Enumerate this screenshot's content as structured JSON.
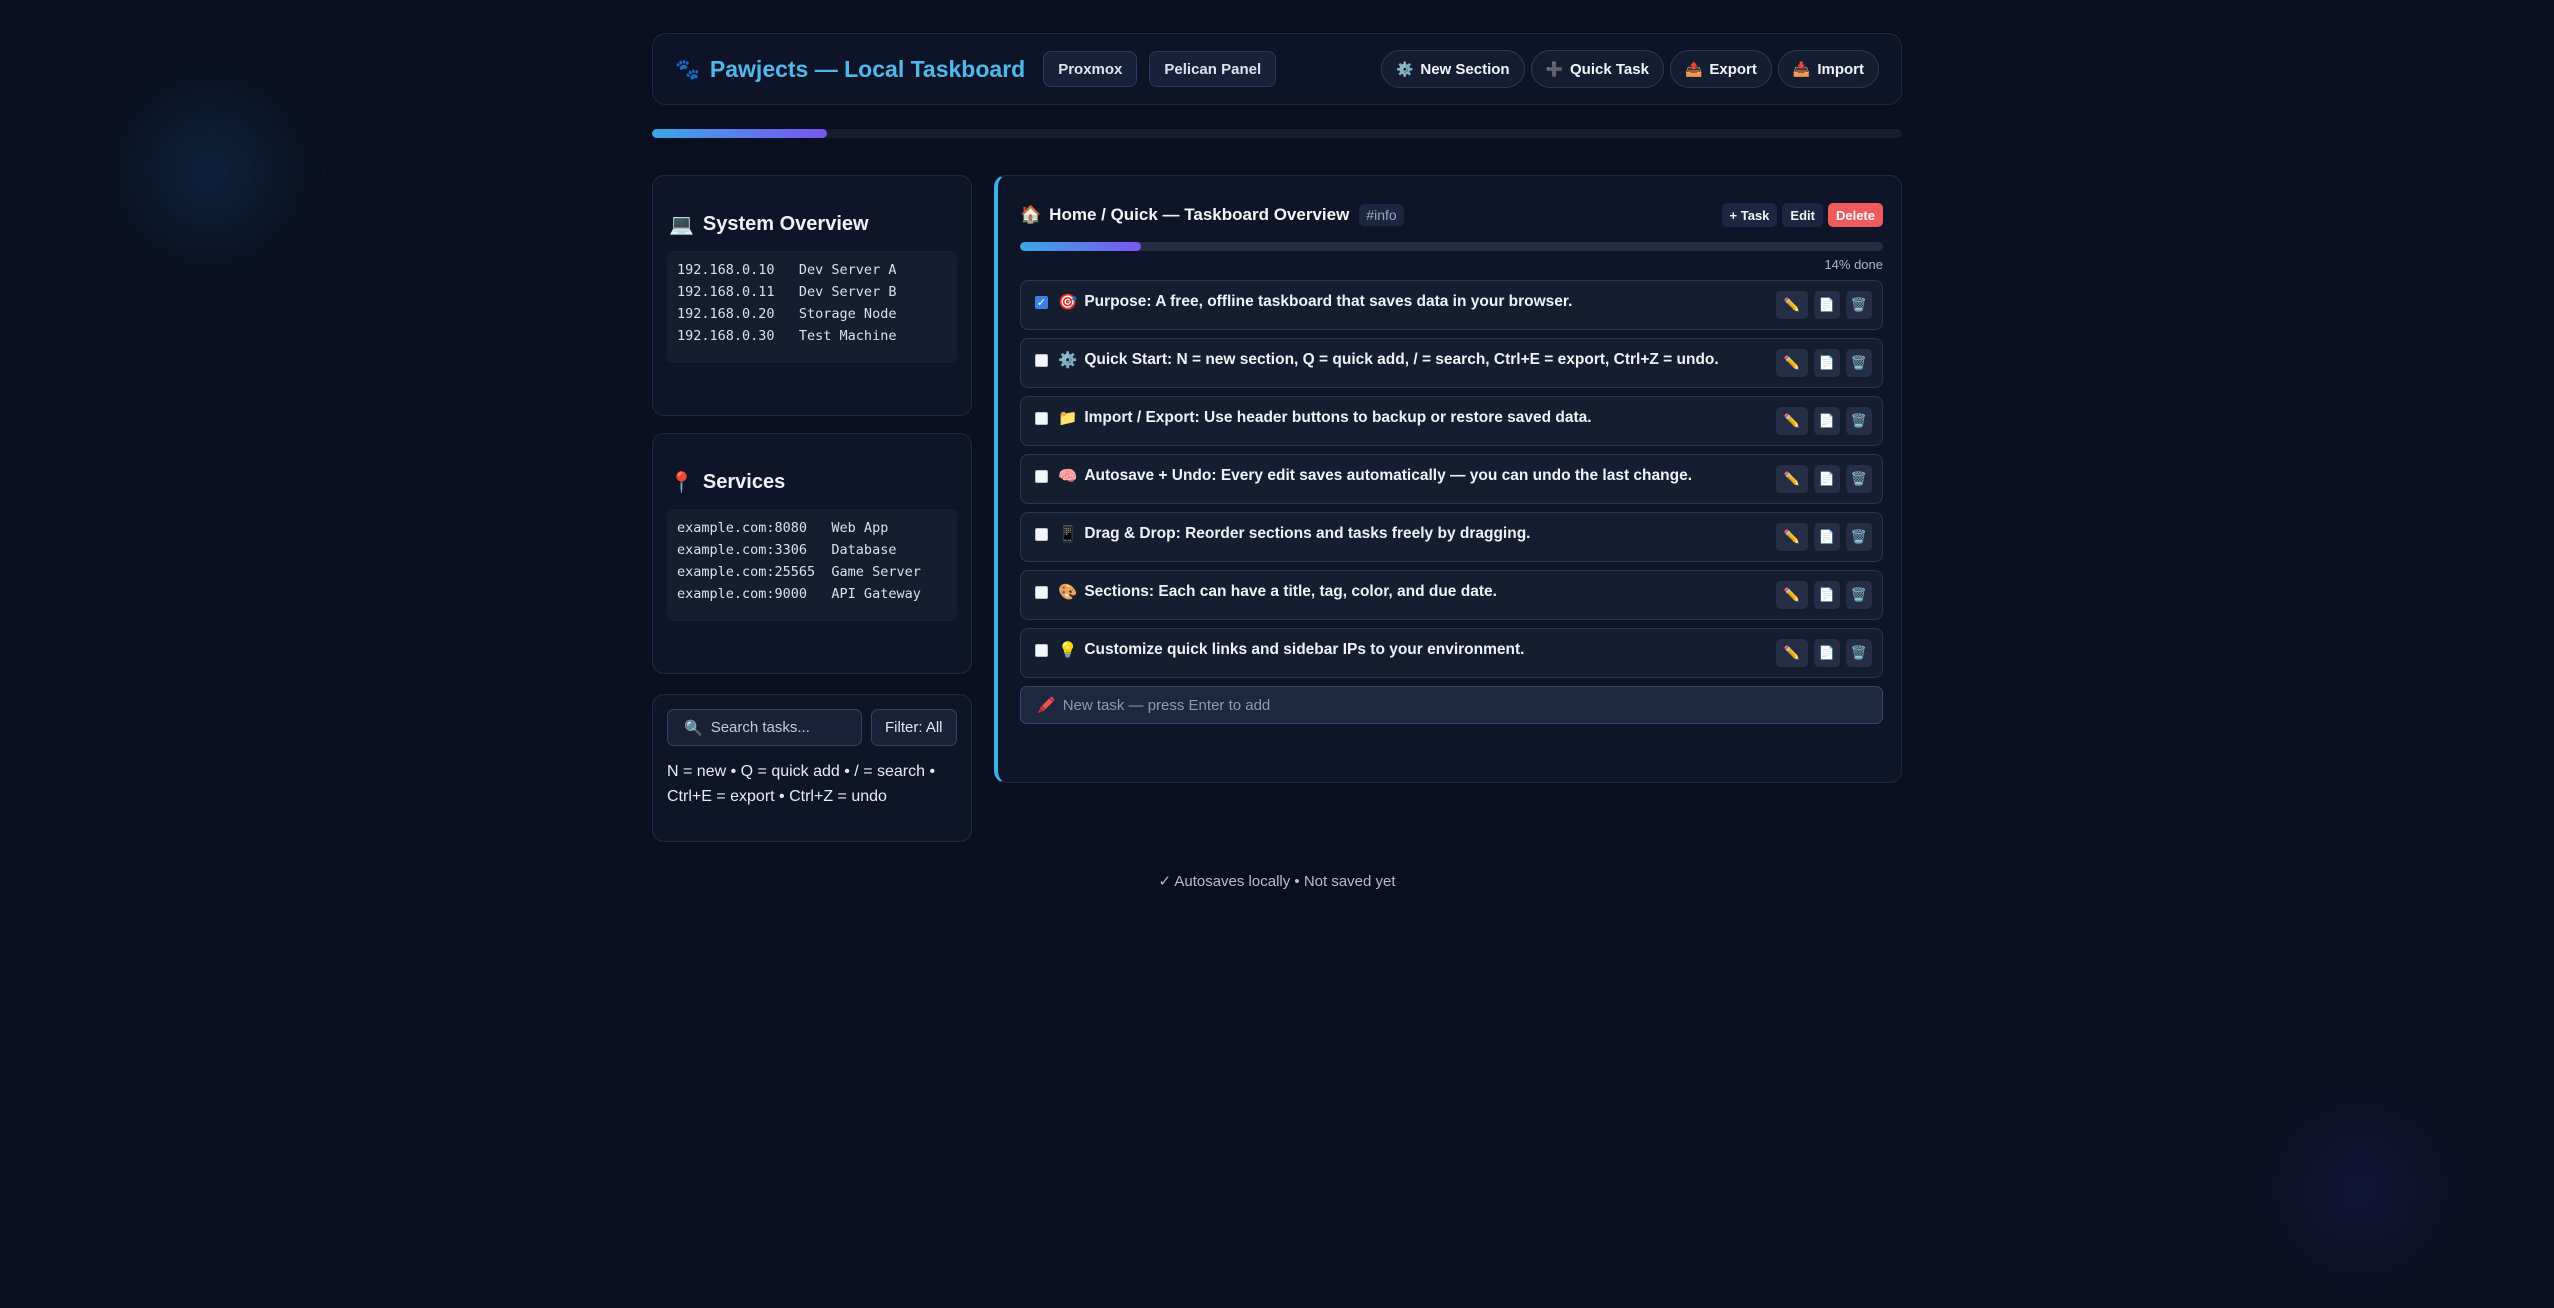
{
  "header": {
    "title": "Pawjects — Local Taskboard",
    "logo_icon": "🐾",
    "links": [
      "Proxmox",
      "Pelican Panel"
    ],
    "actions": [
      {
        "icon": "⚙️",
        "label": "New Section"
      },
      {
        "icon": "➕",
        "label": "Quick Task"
      },
      {
        "icon": "📤",
        "label": "Export"
      },
      {
        "icon": "📥",
        "label": "Import"
      }
    ]
  },
  "overall_progress": 0.14,
  "sidebar": {
    "system": {
      "icon": "💻",
      "title": "System Overview",
      "text": "192.168.0.10   Dev Server A\n192.168.0.11   Dev Server B\n192.168.0.20   Storage Node\n192.168.0.30   Test Machine"
    },
    "services": {
      "icon": "📍",
      "title": "Services",
      "text": "example.com:8080   Web App\nexample.com:3306   Database\nexample.com:25565  Game Server\nexample.com:9000   API Gateway"
    },
    "search_placeholder": "Search tasks...",
    "filter": "Filter: All",
    "shortcuts": "N = new • Q = quick add • / = search • Ctrl+E = export • Ctrl+Z = undo"
  },
  "section": {
    "icon": "🏠",
    "title": "Home / Quick — Taskboard Overview",
    "tag": "#info",
    "actions": [
      "+ Task",
      "Edit",
      "Delete"
    ],
    "progress": 0.14,
    "progress_text": "14% done",
    "tasks": [
      {
        "checked": true,
        "icon": "🎯",
        "text": "Purpose: A free, offline taskboard that saves data in your browser."
      },
      {
        "checked": false,
        "icon": "⚙️",
        "text": "Quick Start: N = new section, Q = quick add, / = search, Ctrl+E = export, Ctrl+Z = undo."
      },
      {
        "checked": false,
        "icon": "📁",
        "text": "Import / Export: Use header buttons to backup or restore saved data."
      },
      {
        "checked": false,
        "icon": "🧠",
        "text": "Autosave + Undo: Every edit saves automatically — you can undo the last change."
      },
      {
        "checked": false,
        "icon": "📱",
        "text": "Drag & Drop: Reorder sections and tasks freely by dragging."
      },
      {
        "checked": false,
        "icon": "🎨",
        "text": "Sections: Each can have a title, tag, color, and due date."
      },
      {
        "checked": false,
        "icon": "💡",
        "text": "Customize quick links and sidebar IPs to your environment."
      }
    ],
    "new_task_placeholder": "New task — press Enter to add",
    "new_task_icon": "🖍️"
  },
  "footer": "✓ Autosaves locally • Not saved yet"
}
